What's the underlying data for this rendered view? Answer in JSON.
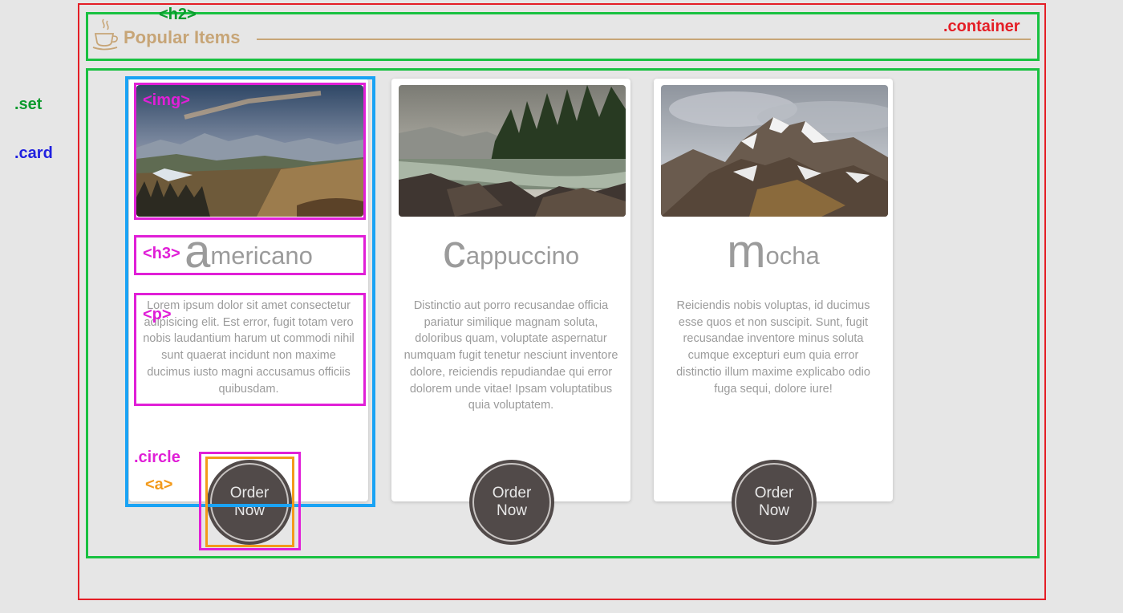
{
  "section": {
    "heading": "Popular Items",
    "cup_icon": "coffee-cup-icon",
    "accent_color": "#c7a577"
  },
  "cards": [
    {
      "initial": "a",
      "rest": "mericano",
      "description": "Lorem ipsum dolor sit amet consectetur adipisicing elit. Est error, fugit totam vero nobis laudantium harum ut commodi nihil sunt quaerat incidunt non maxime ducimus iusto magni accusamus officiis quibusdam.",
      "button": "Order Now",
      "image": "mountain-sunset-landscape"
    },
    {
      "initial": "c",
      "rest": "appuccino",
      "description": "Distinctio aut porro recusandae officia pariatur similique magnam soluta, doloribus quam, voluptate aspernatur numquam fugit tenetur nesciunt inventore dolore, reiciendis repudiandae qui error dolorem unde vitae! Ipsam voluptatibus quia voluptatem.",
      "button": "Order Now",
      "image": "forest-river-landscape"
    },
    {
      "initial": "m",
      "rest": "ocha",
      "description": "Reiciendis nobis voluptas, id ducimus esse quos et non suscipit. Sunt, fugit recusandae inventore minus soluta cumque excepturi eum quia error distinctio illum maxime explicabo odio fuga sequi, dolore iure!",
      "button": "Order Now",
      "image": "snowy-mountain-landscape"
    }
  ],
  "annotations": {
    "h2": "<h2>",
    "container": ".container",
    "set": ".set",
    "card": ".card",
    "img": "<img>",
    "h3": "<h3>",
    "p": "<p>",
    "circle": ".circle",
    "a": "<a>"
  },
  "colors": {
    "container": "#e41e26",
    "set": "#19c141",
    "card": "#1aa3f4",
    "element": "#e01fd7",
    "link": "#f39a1b",
    "button": "#514a49"
  }
}
